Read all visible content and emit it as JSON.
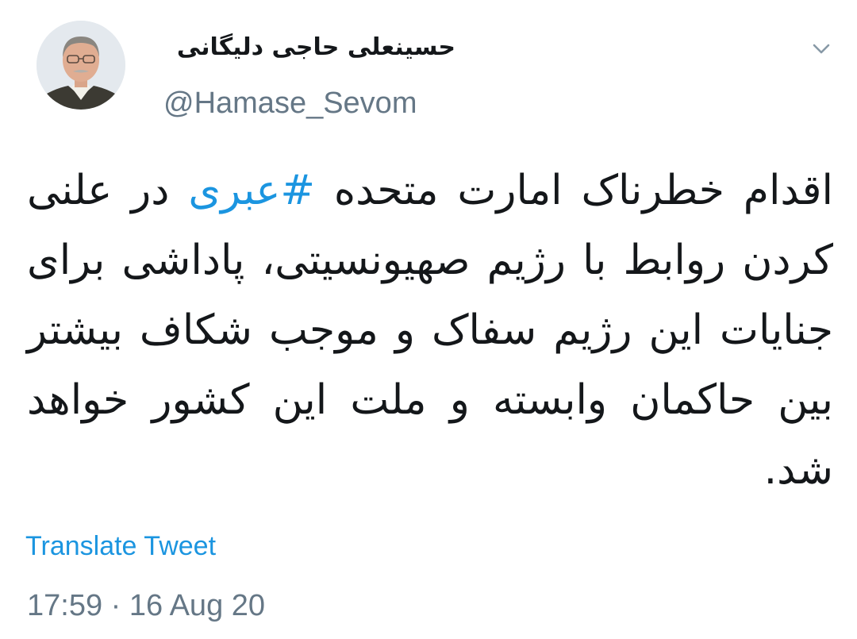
{
  "user": {
    "display_name": "حسینعلی حاجی دلیگانی",
    "handle": "@Hamase_Sevom",
    "avatar_icon": "profile-photo"
  },
  "menu": {
    "icon": "chevron-down-icon"
  },
  "tweet": {
    "text_before": "اقدام خطرناک امارت متحده ",
    "hashtag": "#عبری",
    "text_after": " در علنی کردن روابط با رژیم صهیونسیتی، پاداشی برای جنایات این رژیم سفاک و موجب شکاف بیشتر بین حاکمان وابسته و ملت این کشور خواهد شد."
  },
  "actions": {
    "translate_label": "Translate Tweet"
  },
  "meta": {
    "timestamp": "17:59 · 16 Aug 20"
  },
  "colors": {
    "text": "#14171a",
    "secondary": "#657786",
    "link": "#1b95e0"
  }
}
